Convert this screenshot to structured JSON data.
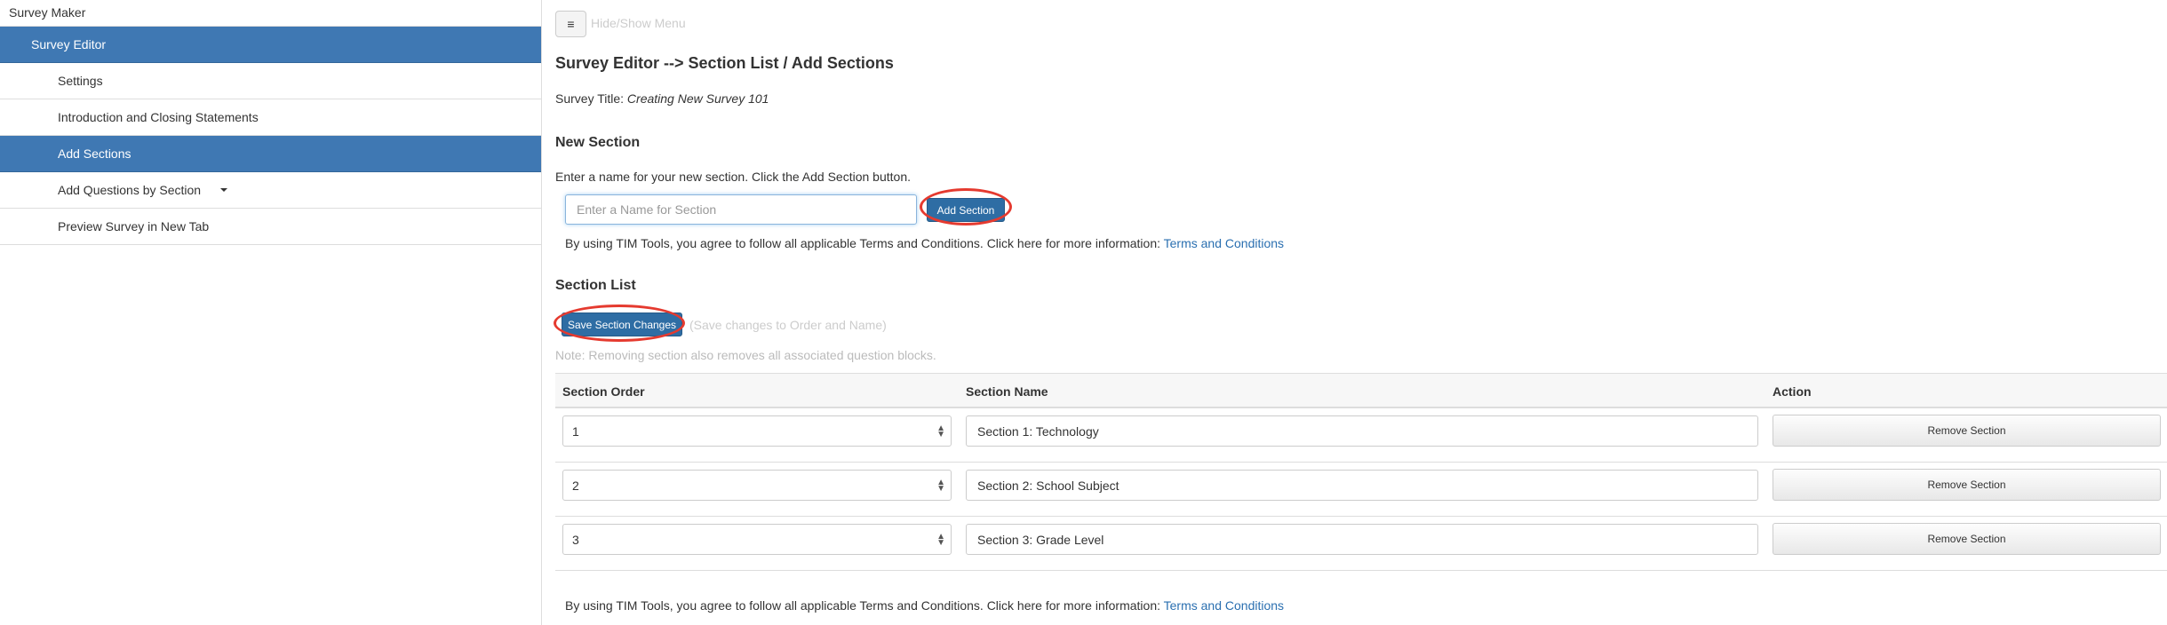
{
  "sidebar": {
    "items": [
      {
        "label": "Survey Maker"
      },
      {
        "label": "Survey Editor"
      },
      {
        "label": "Settings"
      },
      {
        "label": "Introduction and Closing Statements"
      },
      {
        "label": "Add Sections"
      },
      {
        "label": "Add Questions by Section"
      },
      {
        "label": "Preview Survey in New Tab"
      }
    ]
  },
  "toolbar": {
    "menu_icon": "≡",
    "menu_hint": "Hide/Show Menu"
  },
  "page": {
    "title": "Survey Editor --> Section List / Add Sections",
    "survey_title_label": "Survey Title:",
    "survey_title_value": "Creating New Survey 101"
  },
  "new_section": {
    "heading": "New Section",
    "instructions": "Enter a name for your new section. Click the Add Section button.",
    "input_placeholder": "Enter a Name for Section",
    "input_value": "",
    "add_button": "Add Section"
  },
  "terms": {
    "text": "By using TIM Tools, you agree to follow all applicable Terms and Conditions. Click here for more information:",
    "link": "Terms and Conditions"
  },
  "section_list": {
    "heading": "Section List",
    "save_button": "Save Section Changes",
    "save_hint": "(Save changes to Order and Name)",
    "note": "Note: Removing section also removes all associated question blocks.",
    "columns": [
      "Section Order",
      "Section Name",
      "Action"
    ],
    "rows": [
      {
        "order": "1",
        "name": "Section 1: Technology",
        "action": "Remove Section"
      },
      {
        "order": "2",
        "name": "Section 2: School Subject",
        "action": "Remove Section"
      },
      {
        "order": "3",
        "name": "Section 3: Grade Level",
        "action": "Remove Section"
      }
    ]
  },
  "colors": {
    "active": "#3f78b3",
    "primary_button": "#2e6da4",
    "link": "#2a6fb0",
    "annotation_ring": "#e53a2f"
  }
}
